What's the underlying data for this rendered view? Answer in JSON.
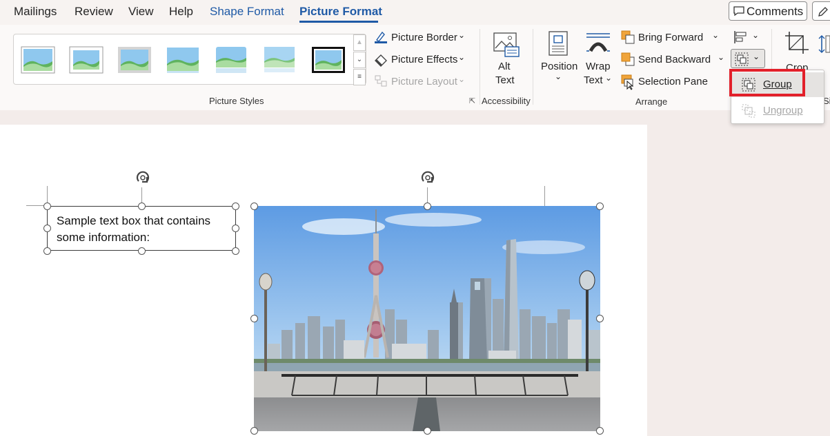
{
  "tabs": [
    {
      "label": "Mailings"
    },
    {
      "label": "Review"
    },
    {
      "label": "View"
    },
    {
      "label": "Help"
    },
    {
      "label": "Shape Format"
    },
    {
      "label": "Picture Format"
    }
  ],
  "header": {
    "comments_label": "Comments"
  },
  "ribbon": {
    "picture_styles": {
      "group_label": "Picture Styles",
      "picture_border": "Picture Border",
      "picture_effects": "Picture Effects",
      "picture_layout": "Picture Layout"
    },
    "accessibility": {
      "group_label": "Accessibility",
      "alt_text_line1": "Alt",
      "alt_text_line2": "Text"
    },
    "arrange": {
      "group_label": "Arrange",
      "position": "Position",
      "wrap_line1": "Wrap",
      "wrap_line2": "Text",
      "bring_forward": "Bring Forward",
      "send_backward": "Send Backward",
      "selection_pane": "Selection Pane"
    },
    "size": {
      "crop": "Crop",
      "size_partial": "Si"
    }
  },
  "group_menu": {
    "group": "Group",
    "ungroup": "Ungroup"
  },
  "document": {
    "textbox_text": "Sample text box that contains some information:"
  },
  "colors": {
    "accent": "#1f5aa6",
    "highlight": "#e2202a"
  }
}
